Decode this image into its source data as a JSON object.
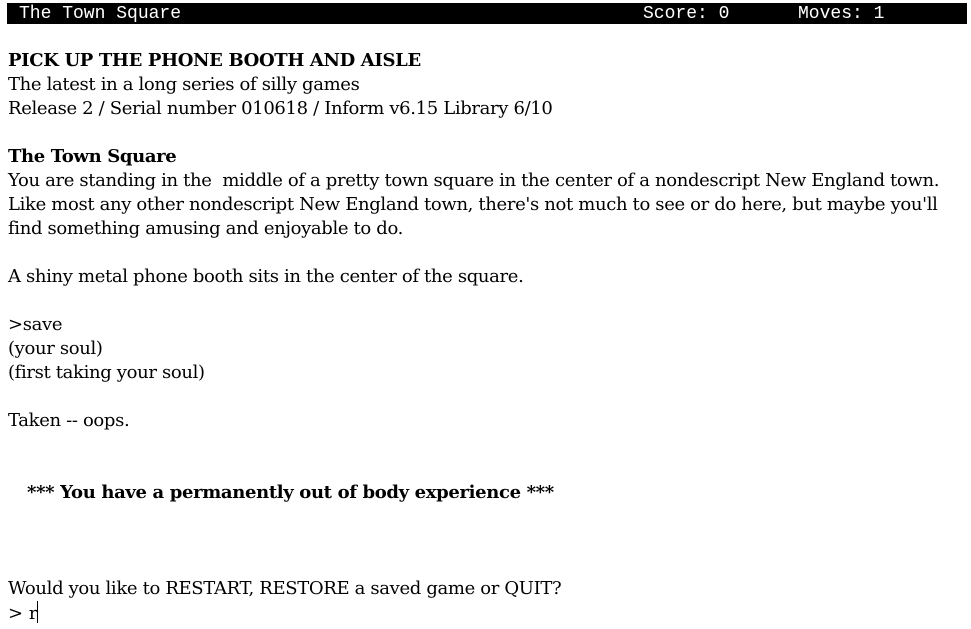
{
  "status_bar": {
    "location": "The Town Square",
    "score_label": "Score: 0",
    "moves_label": "Moves: 1"
  },
  "transcript": {
    "game_title": "PICK UP THE PHONE BOOTH AND AISLE",
    "subtitle": "The latest in a long series of silly games",
    "release_info": "Release 2 / Serial number 010618 / Inform v6.15 Library 6/10",
    "room_name": "The Town Square",
    "room_description": [
      "You are standing in the  middle of a pretty town square in the center of a nondescript New England town.",
      "Like most any other nondescript New England town, there's not much to see or do here, but maybe you'll",
      "find something amusing and enjoyable to do."
    ],
    "object_description": "A shiny metal phone booth sits in the center of the square.",
    "command": ">save",
    "response_lines": [
      "(your soul)",
      "(first taking your soul)"
    ],
    "result": "Taken -- oops.",
    "death_message": "*** You have a permanently out of body experience ***",
    "end_prompt": "Would you like to RESTART, RESTORE a saved game or QUIT?",
    "input_prompt": "> ",
    "input_value": "r"
  }
}
